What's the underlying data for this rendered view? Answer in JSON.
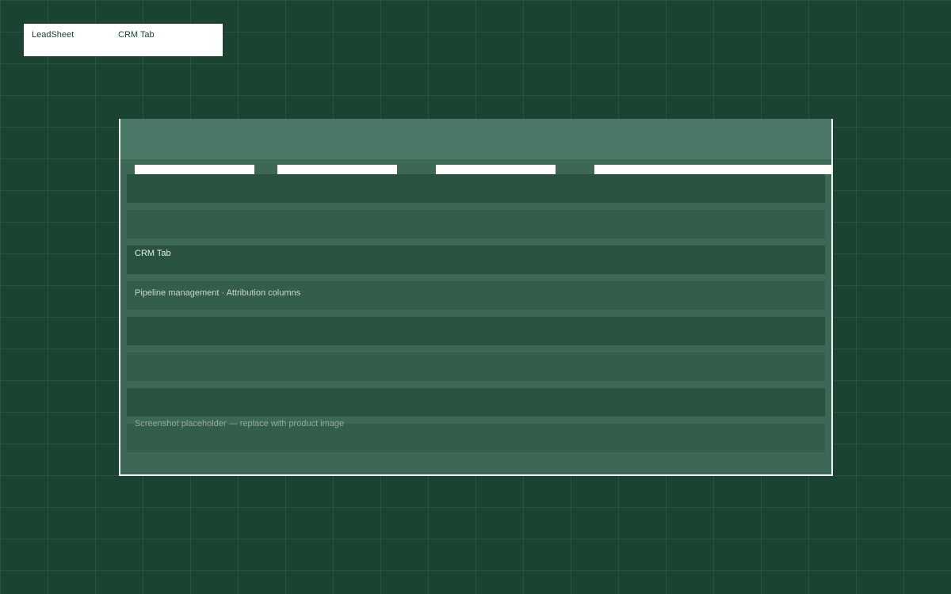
{
  "tag": {
    "brand": "LeadSheet",
    "section": "CRM Tab"
  },
  "screenshot": {
    "tabs": [
      "",
      "",
      "",
      ""
    ],
    "title": "CRM Tab",
    "subtitle": "Pipeline management · Attribution columns",
    "placeholder": "Screenshot placeholder — replace with product image"
  },
  "colors": {
    "background": "#1b4332",
    "frame_header": "#4b7866",
    "row_dark": "#29523f",
    "row_light": "#335e4b",
    "border": "#f3f5f4"
  }
}
